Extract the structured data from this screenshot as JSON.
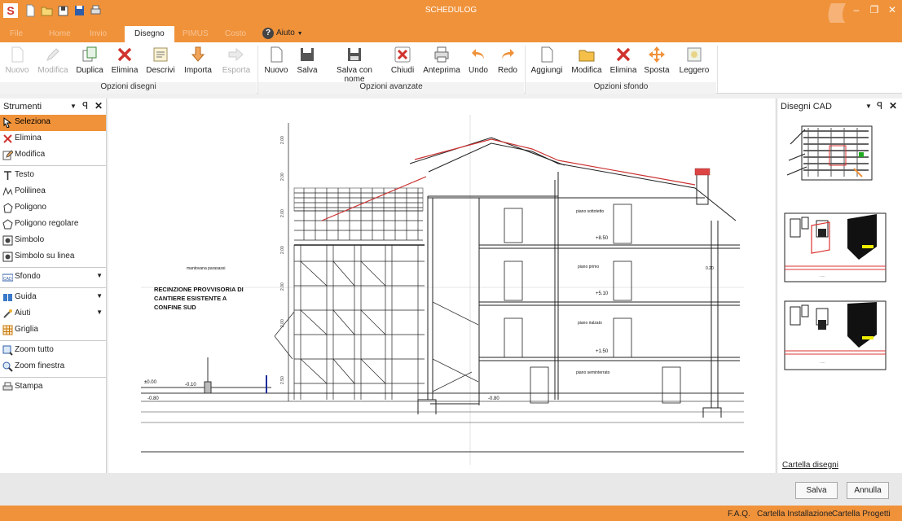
{
  "titlebar": {
    "app_letter": "S",
    "title": "SCHEDULOG",
    "minimize": "–",
    "restore": "❐",
    "close": "✕"
  },
  "menu": {
    "tabs": [
      {
        "label": "File"
      },
      {
        "label": "Home"
      },
      {
        "label": "Invio"
      },
      {
        "label": "Disegno"
      },
      {
        "label": "PIMUS"
      },
      {
        "label": "Costo"
      }
    ],
    "help": "Aiuto"
  },
  "ribbon": {
    "groups": [
      {
        "label": "Opzioni disegni"
      },
      {
        "label": "Opzioni avanzate"
      },
      {
        "label": "Opzioni sfondo"
      }
    ],
    "buttons": {
      "nuovo": "Nuovo",
      "modifica": "Modifica",
      "duplica": "Duplica",
      "elimina": "Elimina",
      "descrivi": "Descrivi",
      "importa": "Importa",
      "esporta": "Esporta",
      "nuovo2": "Nuovo",
      "salva": "Salva",
      "salva_con_nome": "Salva con nome",
      "chiudi": "Chiudi",
      "anteprima": "Anteprima",
      "undo": "Undo",
      "redo": "Redo",
      "aggiungi": "Aggiungi",
      "modifica2": "Modifica",
      "elimina2": "Elimina",
      "sposta": "Sposta",
      "leggero": "Leggero"
    }
  },
  "tools_panel": {
    "title": "Strumenti",
    "items": {
      "seleziona": "Seleziona",
      "elimina": "Elimina",
      "modifica": "Modifica",
      "testo": "Testo",
      "polilinea": "Polilinea",
      "poligono": "Poligono",
      "poligono_regolare": "Poligono regolare",
      "simbolo": "Simbolo",
      "simbolo_su_linea": "Simbolo su linea",
      "sfondo": "Sfondo",
      "guida": "Guida",
      "aiuti": "Aiuti",
      "griglia": "Griglia",
      "zoom_tutto": "Zoom tutto",
      "zoom_finestra": "Zoom finestra",
      "stampa": "Stampa"
    }
  },
  "drawing": {
    "note_title": "RECINZIONE PROVVISORIA DI",
    "note_line2": "CANTIERE ESISTENTE A",
    "note_line3": "CONFINE SUD",
    "label_mantovana": "mantovana parasassi",
    "level_000": "±0.00",
    "level_m010": "-0.10",
    "level_m080": "-0.80",
    "level_m080b": "-0.80",
    "level_150": "+1.50",
    "level_510": "+5.10",
    "level_850": "+8.50",
    "floor_sottotetto": "piano sottotetto",
    "floor_primo": "piano primo",
    "floor_rialzato": "piano rialzato",
    "floor_seminterrato": "piano seminterrato",
    "dim_right": "0.20",
    "dims": [
      "2.00",
      "2.00",
      "2.00",
      "2.00",
      "2.00",
      "2.00",
      "2.50"
    ]
  },
  "cad_panel": {
    "title": "Disegni CAD",
    "link": "Cartella disegni"
  },
  "dialog": {
    "salva": "Salva",
    "annulla": "Annulla"
  },
  "status": {
    "faq": "F.A.Q.",
    "cartella_installazione": "Cartella Installazione",
    "cartella_progetti": "Cartella Progetti"
  },
  "colors": {
    "accent": "#f0923a",
    "delete_red": "#d0332e"
  }
}
